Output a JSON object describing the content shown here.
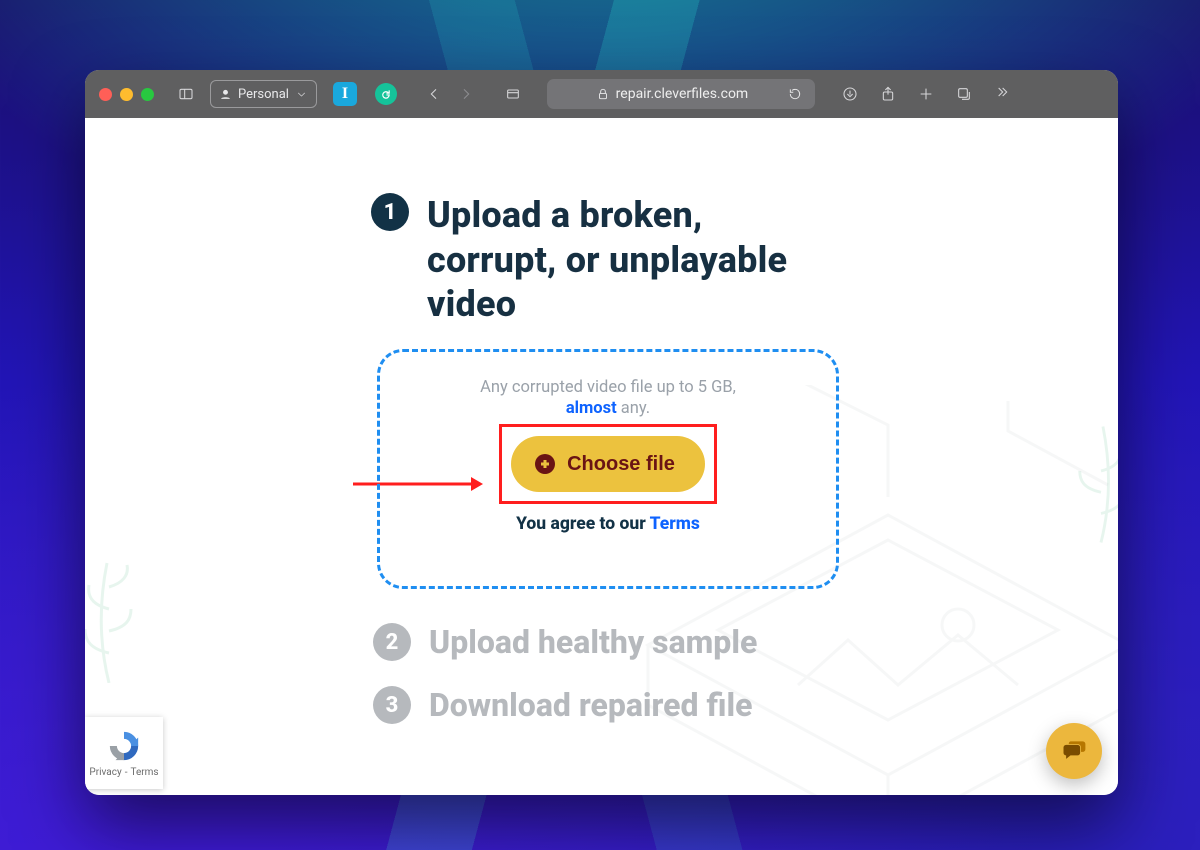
{
  "browser": {
    "profile_label": "Personal",
    "ext_i_letter": "I",
    "address_host": "repair.cleverfiles.com"
  },
  "step1": {
    "badge": "1",
    "title": "Upload a broken, corrupt, or unplayable video"
  },
  "dropzone": {
    "line1": "Any corrupted video file up to 5 GB,",
    "almost": "almost",
    "any_suffix": " any.",
    "choose_label": "Choose file",
    "agree_prefix": "You agree to our ",
    "terms_label": "Terms"
  },
  "step2": {
    "badge": "2",
    "title": "Upload healthy sample"
  },
  "step3": {
    "badge": "3",
    "title": "Download repaired file"
  },
  "recaptcha": {
    "privacy": "Privacy",
    "dash": "-",
    "terms": "Terms"
  }
}
